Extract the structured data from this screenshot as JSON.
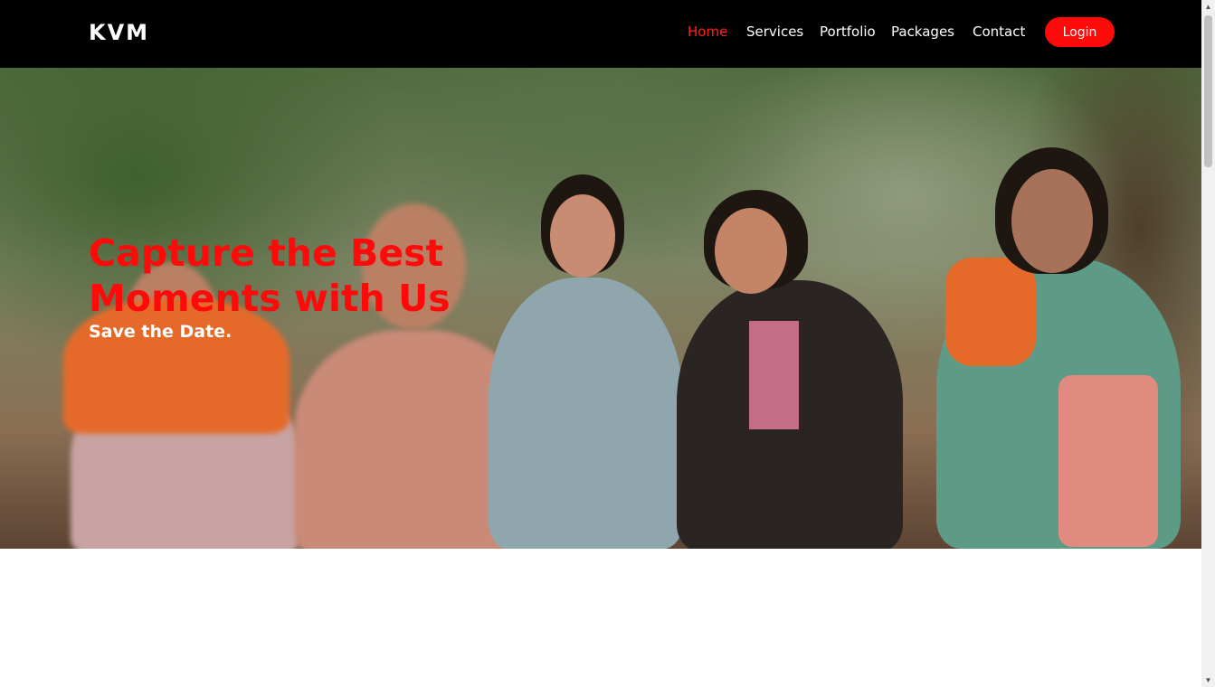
{
  "brand": {
    "logo": "KVM"
  },
  "nav": {
    "items": [
      {
        "label": "Home",
        "active": true
      },
      {
        "label": "Services",
        "active": false
      },
      {
        "label": "Portfolio",
        "active": false
      },
      {
        "label": "Packages",
        "active": false
      },
      {
        "label": "Contact",
        "active": false
      }
    ],
    "login_label": "Login"
  },
  "hero": {
    "headline": "Capture the Best Moments with Us",
    "subline": "Save the Date."
  },
  "colors": {
    "accent": "#ff0a0a",
    "nav_background": "#000000",
    "nav_text": "#ffffff"
  },
  "icons": {
    "scroll_up": "triangle-up-icon",
    "scroll_down": "triangle-down-icon"
  }
}
